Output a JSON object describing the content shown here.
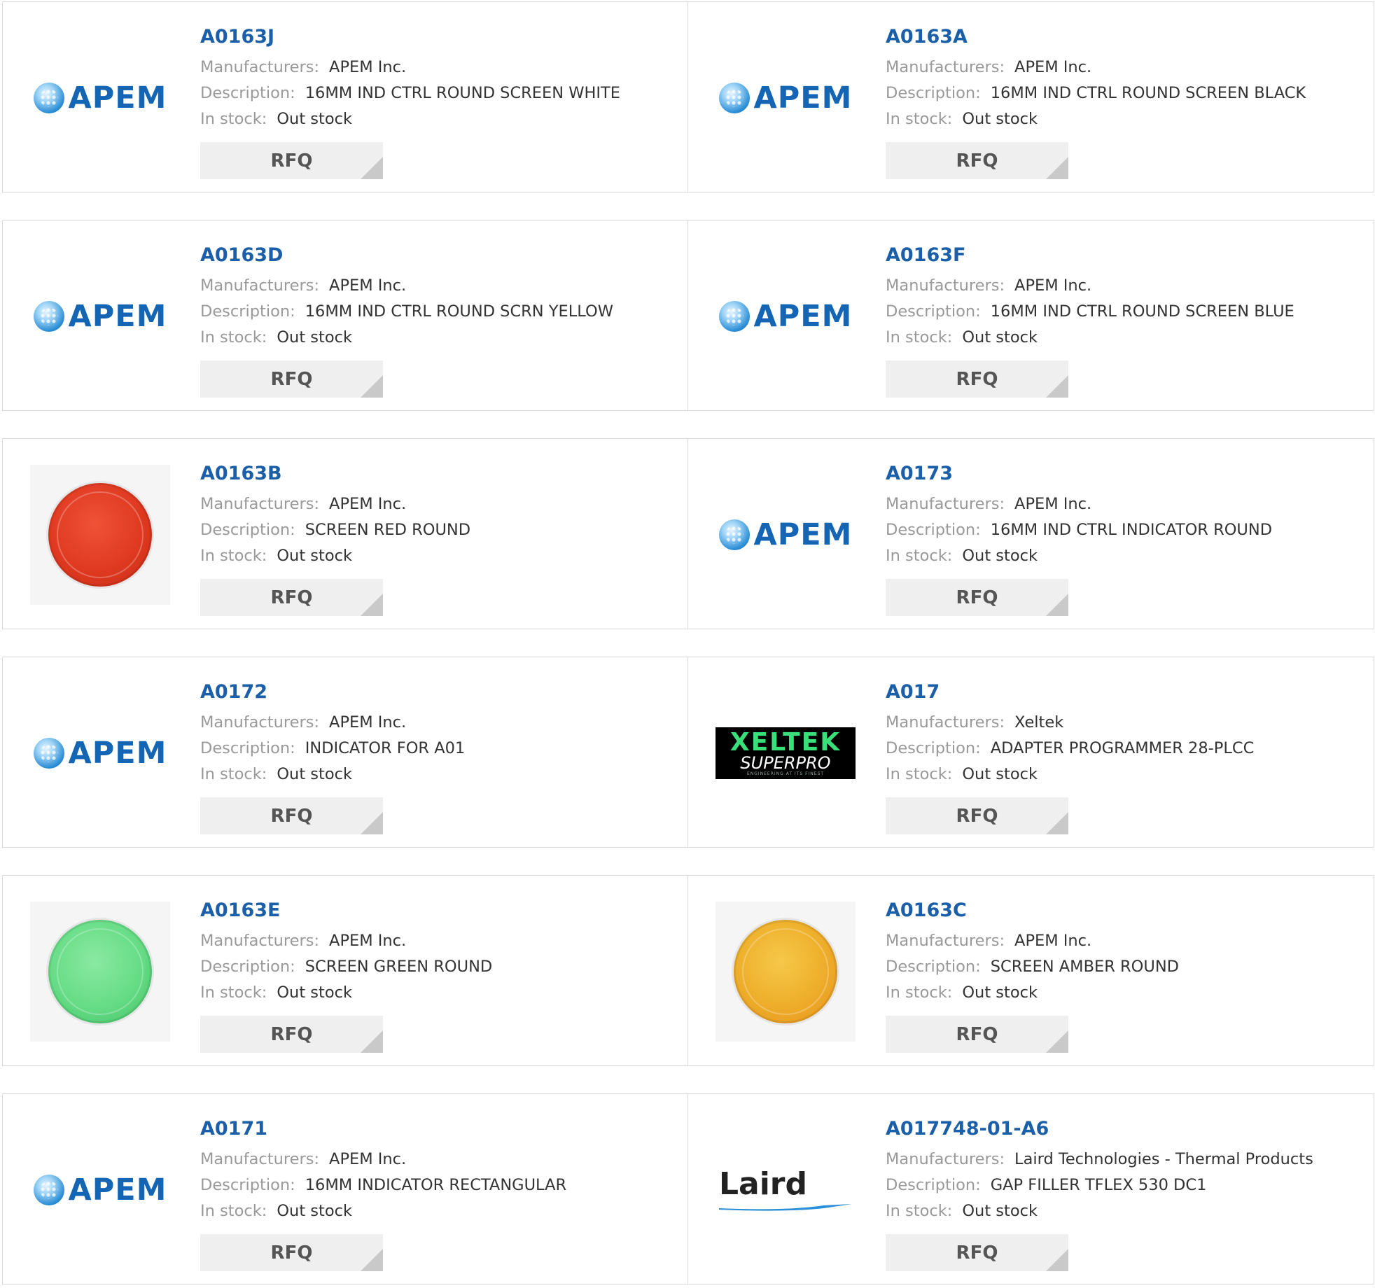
{
  "labels": {
    "manufacturers": "Manufacturers:",
    "description": "Description:",
    "in_stock": "In stock:",
    "rfq": "RFQ"
  },
  "products": [
    {
      "part": "A0163J",
      "manufacturer": "APEM Inc.",
      "description": "16MM IND CTRL ROUND SCREEN WHITE",
      "stock": "Out stock",
      "image": "apem-logo"
    },
    {
      "part": "A0163A",
      "manufacturer": "APEM Inc.",
      "description": "16MM IND CTRL ROUND SCREEN BLACK",
      "stock": "Out stock",
      "image": "apem-logo"
    },
    {
      "part": "A0163D",
      "manufacturer": "APEM Inc.",
      "description": "16MM IND CTRL ROUND SCRN YELLOW",
      "stock": "Out stock",
      "image": "apem-logo"
    },
    {
      "part": "A0163F",
      "manufacturer": "APEM Inc.",
      "description": "16MM IND CTRL ROUND SCREEN BLUE",
      "stock": "Out stock",
      "image": "apem-logo"
    },
    {
      "part": "A0163B",
      "manufacturer": "APEM Inc.",
      "description": "SCREEN RED ROUND",
      "stock": "Out stock",
      "image": "red-round-lens"
    },
    {
      "part": "A0173",
      "manufacturer": "APEM Inc.",
      "description": "16MM IND CTRL INDICATOR ROUND",
      "stock": "Out stock",
      "image": "apem-logo"
    },
    {
      "part": "A0172",
      "manufacturer": "APEM Inc.",
      "description": "INDICATOR FOR A01",
      "stock": "Out stock",
      "image": "apem-logo"
    },
    {
      "part": "A017",
      "manufacturer": "Xeltek",
      "description": "ADAPTER PROGRAMMER 28-PLCC",
      "stock": "Out stock",
      "image": "xeltek-logo"
    },
    {
      "part": "A0163E",
      "manufacturer": "APEM Inc.",
      "description": "SCREEN GREEN ROUND",
      "stock": "Out stock",
      "image": "green-round-lens"
    },
    {
      "part": "A0163C",
      "manufacturer": "APEM Inc.",
      "description": "SCREEN AMBER ROUND",
      "stock": "Out stock",
      "image": "amber-round-lens"
    },
    {
      "part": "A0171",
      "manufacturer": "APEM Inc.",
      "description": "16MM INDICATOR RECTANGULAR",
      "stock": "Out stock",
      "image": "apem-logo"
    },
    {
      "part": "A017748-01-A6",
      "manufacturer": "Laird Technologies - Thermal Products",
      "description": "GAP FILLER TFLEX 530 DC1",
      "stock": "Out stock",
      "image": "laird-logo"
    }
  ],
  "logos": {
    "apem": "APEM",
    "xeltek_top": "XELTEK",
    "xeltek_bottom": "SUPERPRO",
    "xeltek_tag": "ENGINEERING AT ITS FINEST",
    "laird": "Laird"
  },
  "colors": {
    "part_link": "#1a5fa8",
    "label": "#999999",
    "value": "#333333",
    "rfq_bg": "#efefef",
    "lens_red": "#e03a22",
    "lens_green": "#5fd47e",
    "lens_amber": "#f0a323"
  }
}
